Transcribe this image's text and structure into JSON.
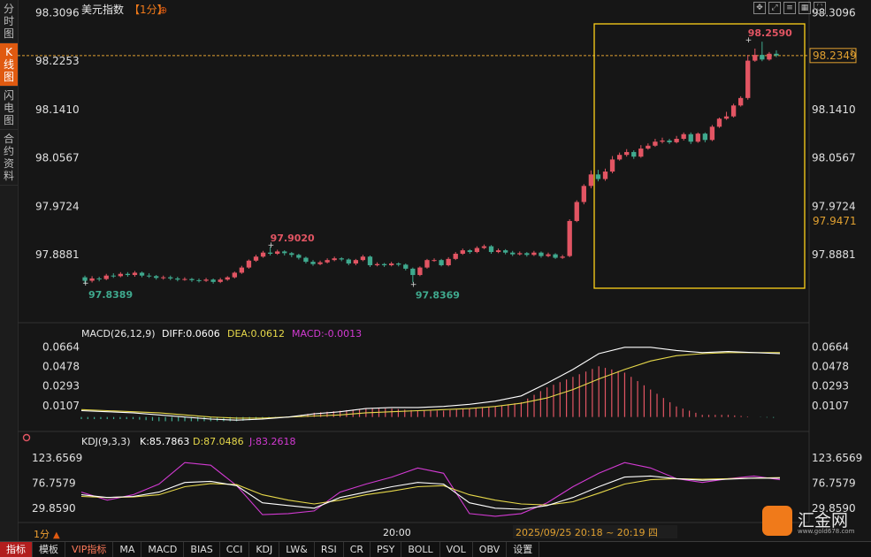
{
  "sidebar": {
    "items": [
      {
        "label": "分时图",
        "active": false
      },
      {
        "label": "K线图",
        "active": true
      },
      {
        "label": "闪电图",
        "active": false
      },
      {
        "label": "合约资料",
        "active": false
      }
    ]
  },
  "header": {
    "title": "美元指数",
    "period": "【1分】",
    "add_icon": "⊕",
    "icons": [
      "move-icon",
      "expand-icon",
      "list-icon",
      "grid-icon",
      "fullscreen-icon"
    ]
  },
  "main_axis": {
    "ticks_left": [
      "98.3096",
      "98.2253",
      "98.1410",
      "98.0567",
      "97.9724",
      "97.8881"
    ],
    "ticks_right": [
      "98.3096",
      "98.1410",
      "98.0567",
      "97.9724",
      "97.8881"
    ],
    "current_price": "98.2349",
    "box_low_label": "97.9471"
  },
  "macd_panel": {
    "title": "MACD(26,12,9)",
    "diff": "DIFF:0.0606",
    "dea": "DEA:0.0612",
    "macd": "MACD:-0.0013",
    "ticks": [
      "0.0664",
      "0.0478",
      "0.0293",
      "0.0107"
    ]
  },
  "kdj_panel": {
    "title": "KDJ(9,3,3)",
    "k": "K:85.7863",
    "d": "D:87.0486",
    "j": "J:83.2618",
    "ticks": [
      "123.6569",
      "76.7579",
      "29.8590"
    ]
  },
  "time_axis": {
    "period": "1分",
    "tick": "20:00",
    "range": "2025/09/25 20:18 ~ 20:19 四"
  },
  "toolbar": {
    "items": [
      "指标",
      "模板",
      "VIP指标",
      "MA",
      "MACD",
      "BIAS",
      "CCI",
      "KDJ",
      "LW&",
      "RSI",
      "CR",
      "PSY",
      "BOLL",
      "VOL",
      "OBV",
      "设置"
    ]
  },
  "logo": {
    "name": "汇金网",
    "url": "www.gold678.com"
  },
  "colors": {
    "up": "#e25563",
    "down": "#3fa98e",
    "bg": "#161616",
    "diff": "#ffffff",
    "dea": "#e6d84a",
    "macd_label": "#d23ad2",
    "highlight_box": "#ffd21a",
    "price_line": "#e0a030"
  },
  "chart_data": [
    {
      "type": "candlestick",
      "title": "美元指数【1分】",
      "ylim": [
        97.83,
        98.31
      ],
      "annotations": {
        "high": "98.2590",
        "low": "97.8369",
        "prev_low": "97.8389",
        "prev_high": "97.9020"
      },
      "candles": [
        [
          97.849,
          97.843,
          97.852,
          97.838
        ],
        [
          97.843,
          97.847,
          97.851,
          97.84
        ],
        [
          97.847,
          97.846,
          97.85,
          97.842
        ],
        [
          97.846,
          97.852,
          97.855,
          97.844
        ],
        [
          97.852,
          97.851,
          97.856,
          97.848
        ],
        [
          97.851,
          97.855,
          97.858,
          97.849
        ],
        [
          97.855,
          97.853,
          97.858,
          97.85
        ],
        [
          97.853,
          97.857,
          97.86,
          97.85
        ],
        [
          97.857,
          97.852,
          97.859,
          97.849
        ],
        [
          97.852,
          97.851,
          97.856,
          97.848
        ],
        [
          97.851,
          97.848,
          97.853,
          97.845
        ],
        [
          97.848,
          97.849,
          97.852,
          97.845
        ],
        [
          97.849,
          97.847,
          97.852,
          97.844
        ],
        [
          97.847,
          97.845,
          97.85,
          97.842
        ],
        [
          97.845,
          97.846,
          97.849,
          97.843
        ],
        [
          97.846,
          97.844,
          97.848,
          97.841
        ],
        [
          97.844,
          97.843,
          97.847,
          97.84
        ],
        [
          97.843,
          97.845,
          97.848,
          97.841
        ],
        [
          97.845,
          97.841,
          97.847,
          97.838
        ],
        [
          97.841,
          97.845,
          97.848,
          97.839
        ],
        [
          97.845,
          97.849,
          97.851,
          97.843
        ],
        [
          97.849,
          97.857,
          97.859,
          97.847
        ],
        [
          97.857,
          97.866,
          97.869,
          97.855
        ],
        [
          97.866,
          97.878,
          97.88,
          97.864
        ],
        [
          97.878,
          97.885,
          97.888,
          97.876
        ],
        [
          97.885,
          97.892,
          97.895,
          97.883
        ],
        [
          97.892,
          97.89,
          97.902,
          97.887
        ],
        [
          97.89,
          97.894,
          97.897,
          97.888
        ],
        [
          97.894,
          97.891,
          97.896,
          97.887
        ],
        [
          97.891,
          97.888,
          97.893,
          97.884
        ],
        [
          97.888,
          97.883,
          97.89,
          97.88
        ],
        [
          97.883,
          97.876,
          97.885,
          97.873
        ],
        [
          97.876,
          97.872,
          97.879,
          97.869
        ],
        [
          97.872,
          97.875,
          97.878,
          97.87
        ],
        [
          97.875,
          97.879,
          97.882,
          97.873
        ],
        [
          97.879,
          97.882,
          97.885,
          97.877
        ],
        [
          97.882,
          97.88,
          97.884,
          97.877
        ],
        [
          97.88,
          97.873,
          97.882,
          97.87
        ],
        [
          97.873,
          97.879,
          97.881,
          97.87
        ],
        [
          97.879,
          97.885,
          97.888,
          97.877
        ],
        [
          97.885,
          97.87,
          97.887,
          97.867
        ],
        [
          97.87,
          97.872,
          97.875,
          97.868
        ],
        [
          97.872,
          97.87,
          97.874,
          97.867
        ],
        [
          97.87,
          97.873,
          97.876,
          97.868
        ],
        [
          97.873,
          97.871,
          97.875,
          97.868
        ],
        [
          97.871,
          97.864,
          97.873,
          97.861
        ],
        [
          97.864,
          97.853,
          97.866,
          97.84
        ],
        [
          97.853,
          97.866,
          97.868,
          97.851
        ],
        [
          97.866,
          97.879,
          97.881,
          97.864
        ],
        [
          97.879,
          97.879,
          97.882,
          97.876
        ],
        [
          97.879,
          97.87,
          97.881,
          97.868
        ],
        [
          97.87,
          97.881,
          97.884,
          97.868
        ],
        [
          97.881,
          97.89,
          97.893,
          97.879
        ],
        [
          97.89,
          97.896,
          97.899,
          97.888
        ],
        [
          97.896,
          97.893,
          97.898,
          97.89
        ],
        [
          97.893,
          97.9,
          97.903,
          97.891
        ],
        [
          97.9,
          97.903,
          97.906,
          97.898
        ],
        [
          97.903,
          97.893,
          97.905,
          97.89
        ],
        [
          97.893,
          97.896,
          97.899,
          97.891
        ],
        [
          97.896,
          97.892,
          97.898,
          97.889
        ],
        [
          97.892,
          97.889,
          97.895,
          97.886
        ],
        [
          97.889,
          97.891,
          97.894,
          97.887
        ],
        [
          97.891,
          97.888,
          97.893,
          97.885
        ],
        [
          97.888,
          97.892,
          97.895,
          97.886
        ],
        [
          97.892,
          97.886,
          97.894,
          97.883
        ],
        [
          97.886,
          97.889,
          97.892,
          97.884
        ],
        [
          97.889,
          97.883,
          97.891,
          97.881
        ],
        [
          97.883,
          97.885,
          97.888,
          97.881
        ],
        [
          97.886,
          97.947,
          97.95,
          97.884
        ],
        [
          97.947,
          97.98,
          97.983,
          97.945
        ],
        [
          97.98,
          98.008,
          98.011,
          97.976
        ],
        [
          98.008,
          98.028,
          98.035,
          98.004
        ],
        [
          98.028,
          98.02,
          98.036,
          98.016
        ],
        [
          98.02,
          98.033,
          98.038,
          98.017
        ],
        [
          98.033,
          98.054,
          98.06,
          98.03
        ],
        [
          98.054,
          98.062,
          98.066,
          98.052
        ],
        [
          98.062,
          98.067,
          98.072,
          98.059
        ],
        [
          98.067,
          98.059,
          98.07,
          98.055
        ],
        [
          98.059,
          98.073,
          98.079,
          98.057
        ],
        [
          98.073,
          98.078,
          98.082,
          98.071
        ],
        [
          98.078,
          98.085,
          98.09,
          98.076
        ],
        [
          98.085,
          98.087,
          98.092,
          98.082
        ],
        [
          98.087,
          98.084,
          98.09,
          98.081
        ],
        [
          98.084,
          98.09,
          98.095,
          98.082
        ],
        [
          98.09,
          98.098,
          98.101,
          98.087
        ],
        [
          98.098,
          98.085,
          98.101,
          98.081
        ],
        [
          98.085,
          98.099,
          98.101,
          98.083
        ],
        [
          98.099,
          98.088,
          98.101,
          98.084
        ],
        [
          98.088,
          98.111,
          98.114,
          98.086
        ],
        [
          98.111,
          98.125,
          98.127,
          98.109
        ],
        [
          98.125,
          98.129,
          98.137,
          98.123
        ],
        [
          98.129,
          98.148,
          98.151,
          98.127
        ],
        [
          98.148,
          98.161,
          98.164,
          98.146
        ],
        [
          98.161,
          98.226,
          98.236,
          98.158
        ],
        [
          98.226,
          98.236,
          98.247,
          98.224
        ],
        [
          98.236,
          98.228,
          98.259,
          98.225
        ],
        [
          98.228,
          98.238,
          98.241,
          98.226
        ],
        [
          98.238,
          98.235,
          98.244,
          98.232
        ]
      ]
    },
    {
      "type": "macd",
      "ylim": [
        -0.012,
        0.07
      ],
      "diff": [
        0.006,
        0.005,
        0.004,
        0.002,
        0.0,
        -0.002,
        -0.003,
        -0.002,
        0.0,
        0.003,
        0.005,
        0.008,
        0.009,
        0.009,
        0.01,
        0.012,
        0.015,
        0.02,
        0.032,
        0.045,
        0.06,
        0.066,
        0.066,
        0.063,
        0.061,
        0.062,
        0.061,
        0.06
      ],
      "dea": [
        0.007,
        0.006,
        0.005,
        0.004,
        0.002,
        0.0,
        -0.001,
        -0.001,
        0.0,
        0.001,
        0.002,
        0.004,
        0.005,
        0.006,
        0.007,
        0.008,
        0.01,
        0.013,
        0.018,
        0.026,
        0.036,
        0.045,
        0.053,
        0.058,
        0.06,
        0.061,
        0.061,
        0.061
      ],
      "hist": [
        -0.002,
        -0.002,
        -0.002,
        -0.004,
        -0.004,
        -0.004,
        -0.004,
        -0.002,
        0.0,
        0.004,
        0.006,
        0.008,
        0.008,
        0.006,
        0.006,
        0.008,
        0.01,
        0.014,
        0.028,
        0.038,
        0.048,
        0.042,
        0.026,
        0.01,
        0.002,
        0.002,
        0.0,
        -0.001
      ]
    },
    {
      "type": "kdj",
      "ylim": [
        5,
        140
      ],
      "k": [
        55,
        50,
        52,
        60,
        78,
        80,
        72,
        40,
        35,
        30,
        50,
        60,
        70,
        78,
        75,
        40,
        30,
        28,
        35,
        50,
        70,
        88,
        90,
        85,
        82,
        84,
        86,
        86
      ],
      "d": [
        52,
        50,
        51,
        55,
        70,
        76,
        74,
        55,
        45,
        38,
        45,
        55,
        62,
        70,
        72,
        55,
        45,
        38,
        36,
        42,
        58,
        75,
        83,
        85,
        84,
        85,
        86,
        87
      ],
      "j": [
        60,
        45,
        55,
        75,
        115,
        110,
        72,
        18,
        20,
        25,
        60,
        75,
        88,
        105,
        95,
        20,
        15,
        20,
        40,
        70,
        95,
        115,
        105,
        85,
        78,
        85,
        90,
        83
      ]
    }
  ]
}
